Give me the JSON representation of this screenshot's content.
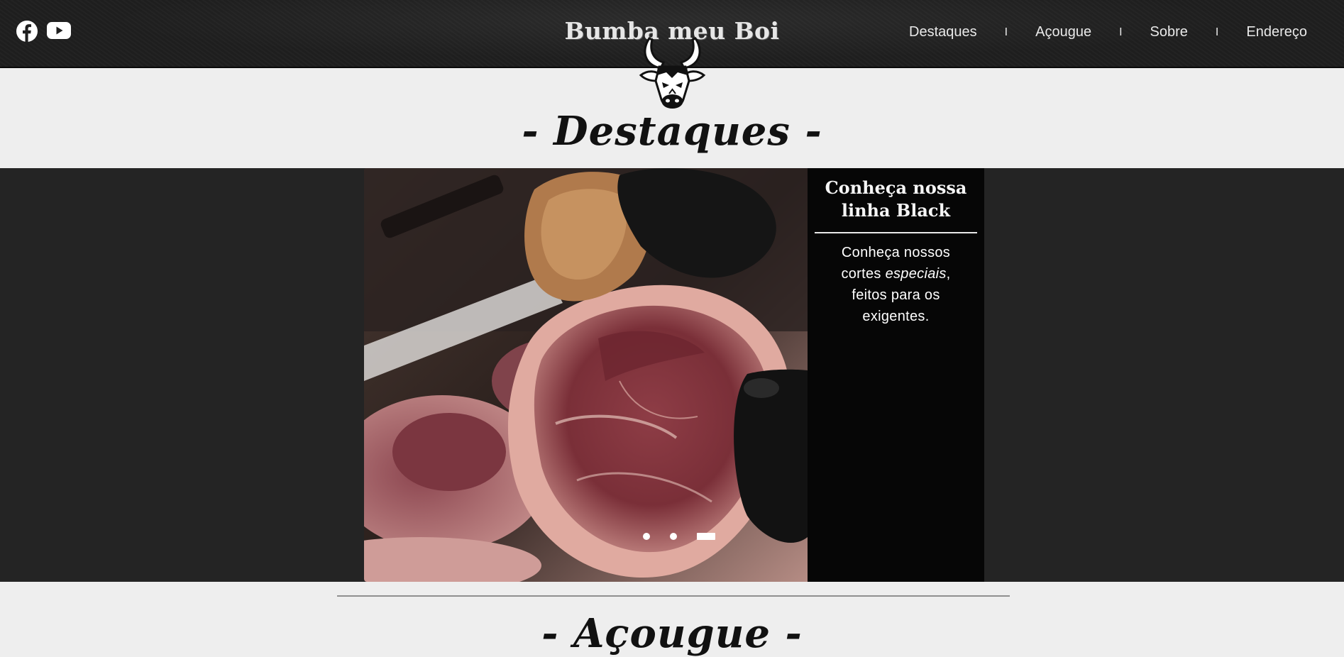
{
  "header": {
    "brand": "Bumba meu Boi",
    "social": [
      {
        "name": "facebook",
        "icon": "facebook-icon"
      },
      {
        "name": "youtube",
        "icon": "youtube-icon"
      }
    ],
    "nav": [
      {
        "label": "Destaques"
      },
      {
        "label": "Açougue"
      },
      {
        "label": "Sobre"
      },
      {
        "label": "Endereço"
      }
    ],
    "separator": "I"
  },
  "sections": {
    "highlights_title": "- Destaques -",
    "butcher_title": "- Açougue -"
  },
  "carousel": {
    "caption_title": "Conheça nossa linha Black",
    "caption_text_1": "Conheça nossos cortes",
    "caption_text_em": "especiais",
    "caption_text_2": ", feitos para os exigentes.",
    "slide_count": 3,
    "active_index": 2,
    "image": "raw-beef-cut-with-black-gloves"
  },
  "colors": {
    "topbar": "#1f1f1f",
    "band": "#242424",
    "page": "#eeeeee",
    "caption_bg": "#060606"
  }
}
